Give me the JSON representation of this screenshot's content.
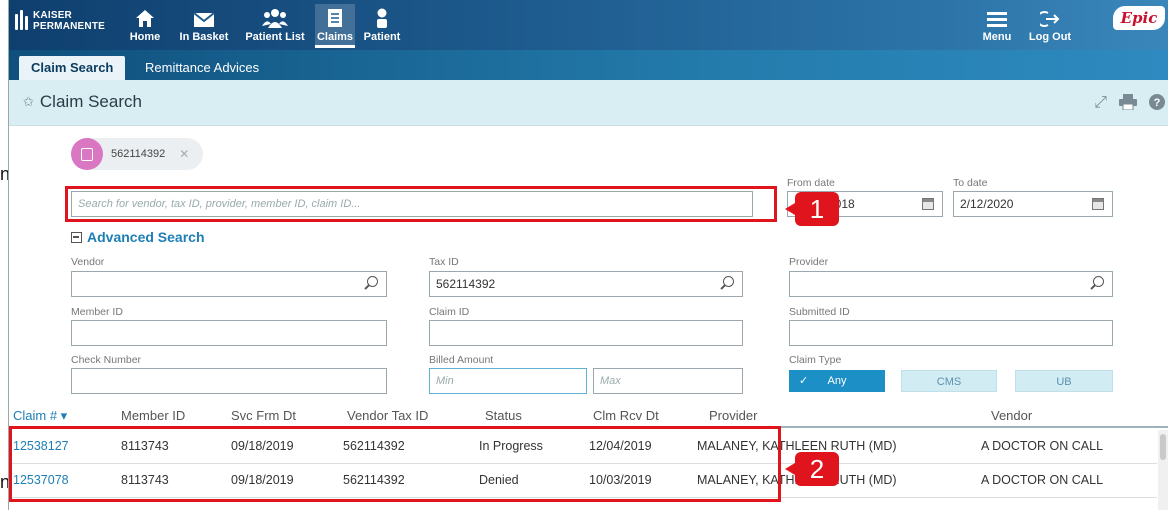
{
  "brand": {
    "line1": "KAISER",
    "line2": "PERMANENTE"
  },
  "nav": [
    {
      "label": "Home",
      "icon": "home-icon"
    },
    {
      "label": "In Basket",
      "icon": "envelope-icon"
    },
    {
      "label": "Patient List",
      "icon": "people-icon"
    },
    {
      "label": "Claims",
      "icon": "document-icon",
      "active": true
    },
    {
      "label": "Patient",
      "icon": "person-icon"
    }
  ],
  "nav_right": [
    {
      "label": "Menu",
      "icon": "hamburger-icon"
    },
    {
      "label": "Log Out",
      "icon": "logout-icon"
    }
  ],
  "logo": "Epic",
  "tabs": [
    {
      "label": "Claim Search",
      "active": true
    },
    {
      "label": "Remittance Advices",
      "active": false
    }
  ],
  "page": {
    "title": "Claim Search"
  },
  "chip": {
    "value": "562114392"
  },
  "search": {
    "placeholder": "Search for vendor, tax ID, provider, member ID, claim ID...",
    "from_label": "From date",
    "from_value": "2018",
    "to_label": "To date",
    "to_value": "2/12/2020"
  },
  "advanced": {
    "toggle_label": "Advanced Search",
    "vendor_label": "Vendor",
    "vendor_value": "",
    "taxid_label": "Tax ID",
    "taxid_value": "562114392",
    "provider_label": "Provider",
    "provider_value": "",
    "member_label": "Member ID",
    "claim_label": "Claim ID",
    "submitted_label": "Submitted ID",
    "check_label": "Check Number",
    "billed_label": "Billed Amount",
    "min_placeholder": "Min",
    "max_placeholder": "Max",
    "claimtype_label": "Claim Type",
    "claimtypes": [
      {
        "label": "Any",
        "selected": true
      },
      {
        "label": "CMS",
        "selected": false
      },
      {
        "label": "UB",
        "selected": false
      }
    ]
  },
  "table": {
    "headers": {
      "claim": "Claim # ▾",
      "member": "Member ID",
      "svc": "Svc Frm Dt",
      "vendortax": "Vendor Tax ID",
      "status": "Status",
      "clmrcv": "Clm Rcv Dt",
      "provider": "Provider",
      "vendor": "Vendor"
    },
    "rows": [
      {
        "claim": "12538127",
        "member": "8113743",
        "svc": "09/18/2019",
        "vendortax": "562114392",
        "status": "In Progress",
        "clmrcv": "12/04/2019",
        "provider": "MALANEY, KATHLEEN RUTH (MD)",
        "vendor": "A DOCTOR ON CALL"
      },
      {
        "claim": "12537078",
        "member": "8113743",
        "svc": "09/18/2019",
        "vendortax": "562114392",
        "status": "Denied",
        "clmrcv": "10/03/2019",
        "provider": "MALANEY, KATHLEEN RUTH (MD)",
        "vendor": "A DOCTOR ON CALL"
      }
    ]
  },
  "callouts": [
    "1",
    "2"
  ],
  "edge_letters": [
    "n",
    "n"
  ],
  "colors": {
    "accent": "#1d7fb5",
    "callout": "#e0141d",
    "header_bg": "#d9eef3"
  }
}
